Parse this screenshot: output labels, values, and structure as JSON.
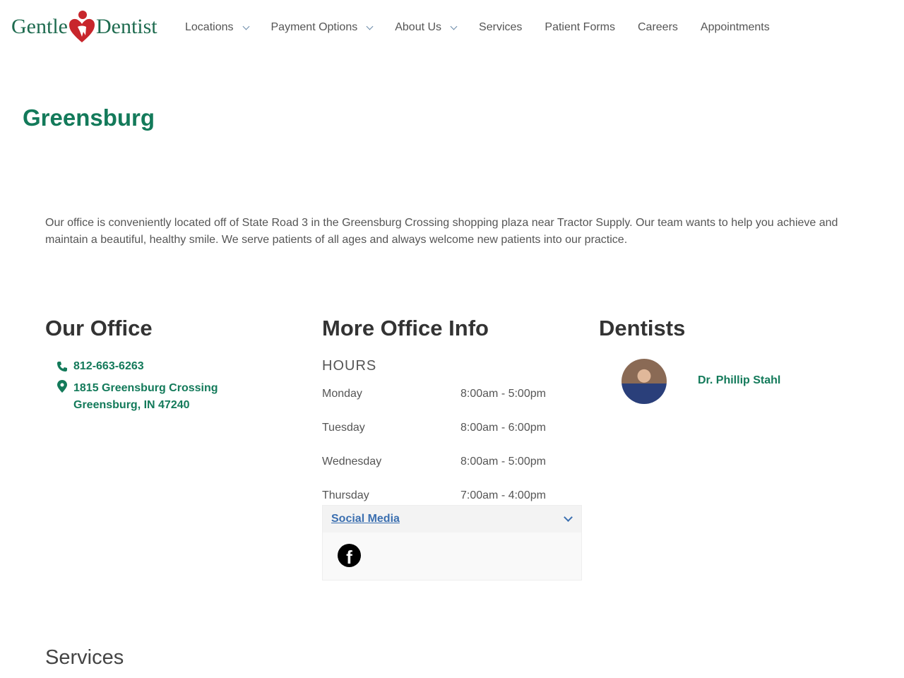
{
  "header": {
    "logo_text_left": "Gentle",
    "logo_text_right": "Dentist",
    "brand_color": "#1e6b4f",
    "logo_heart_color": "#c8262c",
    "nav": [
      {
        "label": "Locations",
        "dropdown": true
      },
      {
        "label": "Payment Options",
        "dropdown": true
      },
      {
        "label": "About Us",
        "dropdown": true
      },
      {
        "label": "Services",
        "dropdown": false
      },
      {
        "label": "Patient Forms",
        "dropdown": false
      },
      {
        "label": "Careers",
        "dropdown": false
      },
      {
        "label": "Appointments",
        "dropdown": false
      }
    ]
  },
  "page": {
    "title": "Greensburg",
    "intro": "Our office is conveniently located off of State Road 3 in the Greensburg Crossing shopping plaza near Tractor Supply. Our team wants to help you achieve and maintain a beautiful, healthy smile. We serve patients of all ages and always welcome new patients into our practice."
  },
  "office": {
    "heading": "Our Office",
    "phone": "812-663-6263",
    "address_line1": "1815 Greensburg Crossing",
    "address_line2": "Greensburg, IN 47240"
  },
  "info": {
    "heading": "More Office Info",
    "hours_label": "HOURS",
    "hours": [
      {
        "day": "Monday",
        "time": "8:00am - 5:00pm"
      },
      {
        "day": "Tuesday",
        "time": "8:00am - 6:00pm"
      },
      {
        "day": "Wednesday",
        "time": "8:00am - 5:00pm"
      },
      {
        "day": "Thursday",
        "time": "7:00am - 4:00pm"
      }
    ],
    "social_label": "Social Media",
    "social_icons": [
      "facebook-icon"
    ]
  },
  "dentists": {
    "heading": "Dentists",
    "items": [
      {
        "name": "Dr. Phillip Stahl"
      }
    ]
  },
  "services": {
    "heading": "Services"
  }
}
